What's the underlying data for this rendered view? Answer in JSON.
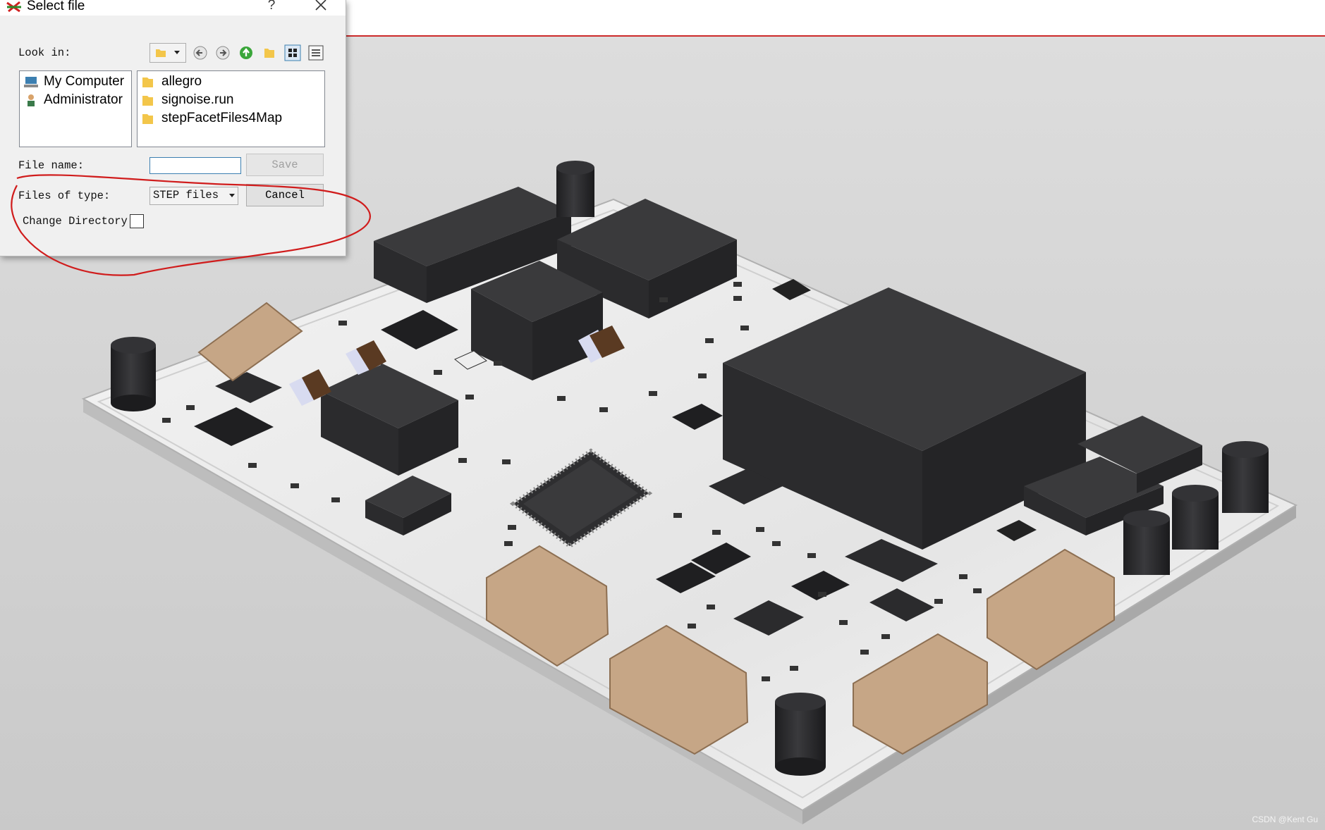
{
  "dialog": {
    "title": "Select file",
    "help_glyph": "?",
    "look_in_label": "Look in:",
    "places": [
      {
        "label": "My Computer",
        "icon": "computer-icon"
      },
      {
        "label": "Administrator",
        "icon": "user-icon"
      }
    ],
    "files": [
      {
        "label": "allegro",
        "icon": "folder-icon"
      },
      {
        "label": "signoise.run",
        "icon": "folder-icon"
      },
      {
        "label": "stepFacetFiles4Map",
        "icon": "folder-icon"
      }
    ],
    "file_name_label": "File name:",
    "file_name_value": "",
    "save_label": "Save",
    "files_of_type_label": "Files of type:",
    "files_of_type_value": "STEP files",
    "cancel_label": "Cancel",
    "change_directory_label": "Change Directory",
    "change_directory_checked": false
  },
  "viewer": {
    "watermark": "CSDN @Kent Gu"
  },
  "colors": {
    "annotation_red": "#d01c1c",
    "accent_blue": "#3c7fb1",
    "pcb_board": "#e8e8e8",
    "component_dark": "#2c2c2e",
    "connector_tan": "#c4a584"
  }
}
